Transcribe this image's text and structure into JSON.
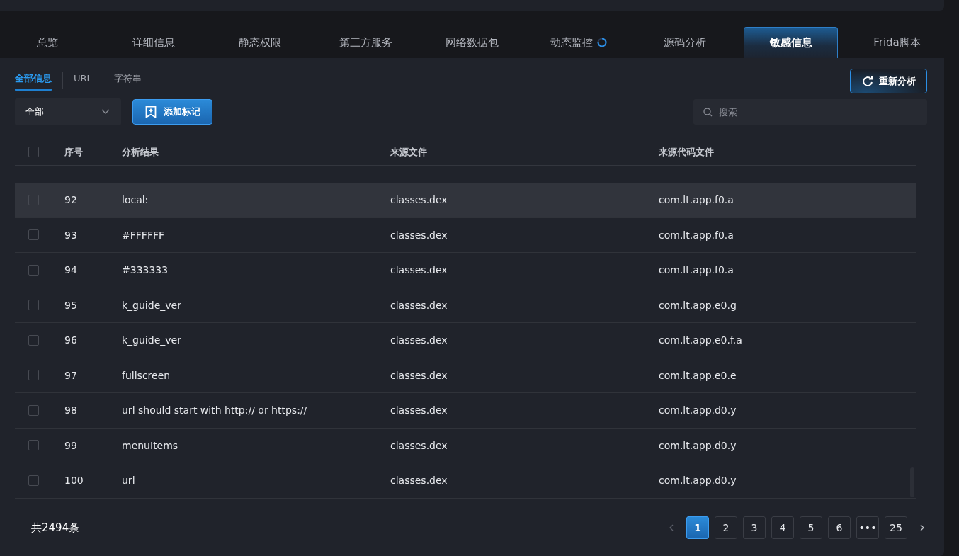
{
  "tabs": [
    {
      "label": "总览",
      "selected": false,
      "loading": false
    },
    {
      "label": "详细信息",
      "selected": false,
      "loading": false
    },
    {
      "label": "静态权限",
      "selected": false,
      "loading": false
    },
    {
      "label": "第三方服务",
      "selected": false,
      "loading": false
    },
    {
      "label": "网络数据包",
      "selected": false,
      "loading": false
    },
    {
      "label": "动态监控",
      "selected": false,
      "loading": true
    },
    {
      "label": "源码分析",
      "selected": false,
      "loading": false
    },
    {
      "label": "敏感信息",
      "selected": true,
      "loading": false
    },
    {
      "label": "Frida脚本",
      "selected": false,
      "loading": false
    }
  ],
  "subtabs": [
    {
      "label": "全部信息",
      "selected": true
    },
    {
      "label": "URL",
      "selected": false
    },
    {
      "label": "字符串",
      "selected": false
    }
  ],
  "reanalyze_button": "重新分析",
  "filter_dropdown": {
    "value": "全部"
  },
  "add_mark_button": "添加标记",
  "search": {
    "placeholder": "搜索"
  },
  "table": {
    "select_all_checked": false,
    "columns": [
      "序号",
      "分析结果",
      "来源文件",
      "来源代码文件"
    ],
    "rows": [
      {
        "cells": [
          "92",
          "local:",
          "classes.dex",
          "com.lt.app.f0.a"
        ],
        "checked": false,
        "selected": true
      },
      {
        "cells": [
          "93",
          "#FFFFFF",
          "classes.dex",
          "com.lt.app.f0.a"
        ],
        "checked": false,
        "selected": false
      },
      {
        "cells": [
          "94",
          "#333333",
          "classes.dex",
          "com.lt.app.f0.a"
        ],
        "checked": false,
        "selected": false
      },
      {
        "cells": [
          "95",
          "k_guide_ver",
          "classes.dex",
          "com.lt.app.e0.g"
        ],
        "checked": false,
        "selected": false
      },
      {
        "cells": [
          "96",
          "k_guide_ver",
          "classes.dex",
          "com.lt.app.e0.f.a"
        ],
        "checked": false,
        "selected": false
      },
      {
        "cells": [
          "97",
          "fullscreen",
          "classes.dex",
          "com.lt.app.e0.e"
        ],
        "checked": false,
        "selected": false
      },
      {
        "cells": [
          "98",
          "url should start with http:// or https://",
          "classes.dex",
          "com.lt.app.d0.y"
        ],
        "checked": false,
        "selected": false
      },
      {
        "cells": [
          "99",
          "menuItems",
          "classes.dex",
          "com.lt.app.d0.y"
        ],
        "checked": false,
        "selected": false
      },
      {
        "cells": [
          "100",
          "url",
          "classes.dex",
          "com.lt.app.d0.y"
        ],
        "checked": false,
        "selected": false
      }
    ]
  },
  "total": "共2494条",
  "pagination": [
    {
      "label": "1",
      "selected": true
    },
    {
      "label": "2",
      "selected": false
    },
    {
      "label": "3",
      "selected": false
    },
    {
      "label": "4",
      "selected": false
    },
    {
      "label": "5",
      "selected": false
    },
    {
      "label": "6",
      "selected": false
    },
    {
      "label": "•••",
      "selected": false
    },
    {
      "label": "25",
      "selected": false
    }
  ]
}
